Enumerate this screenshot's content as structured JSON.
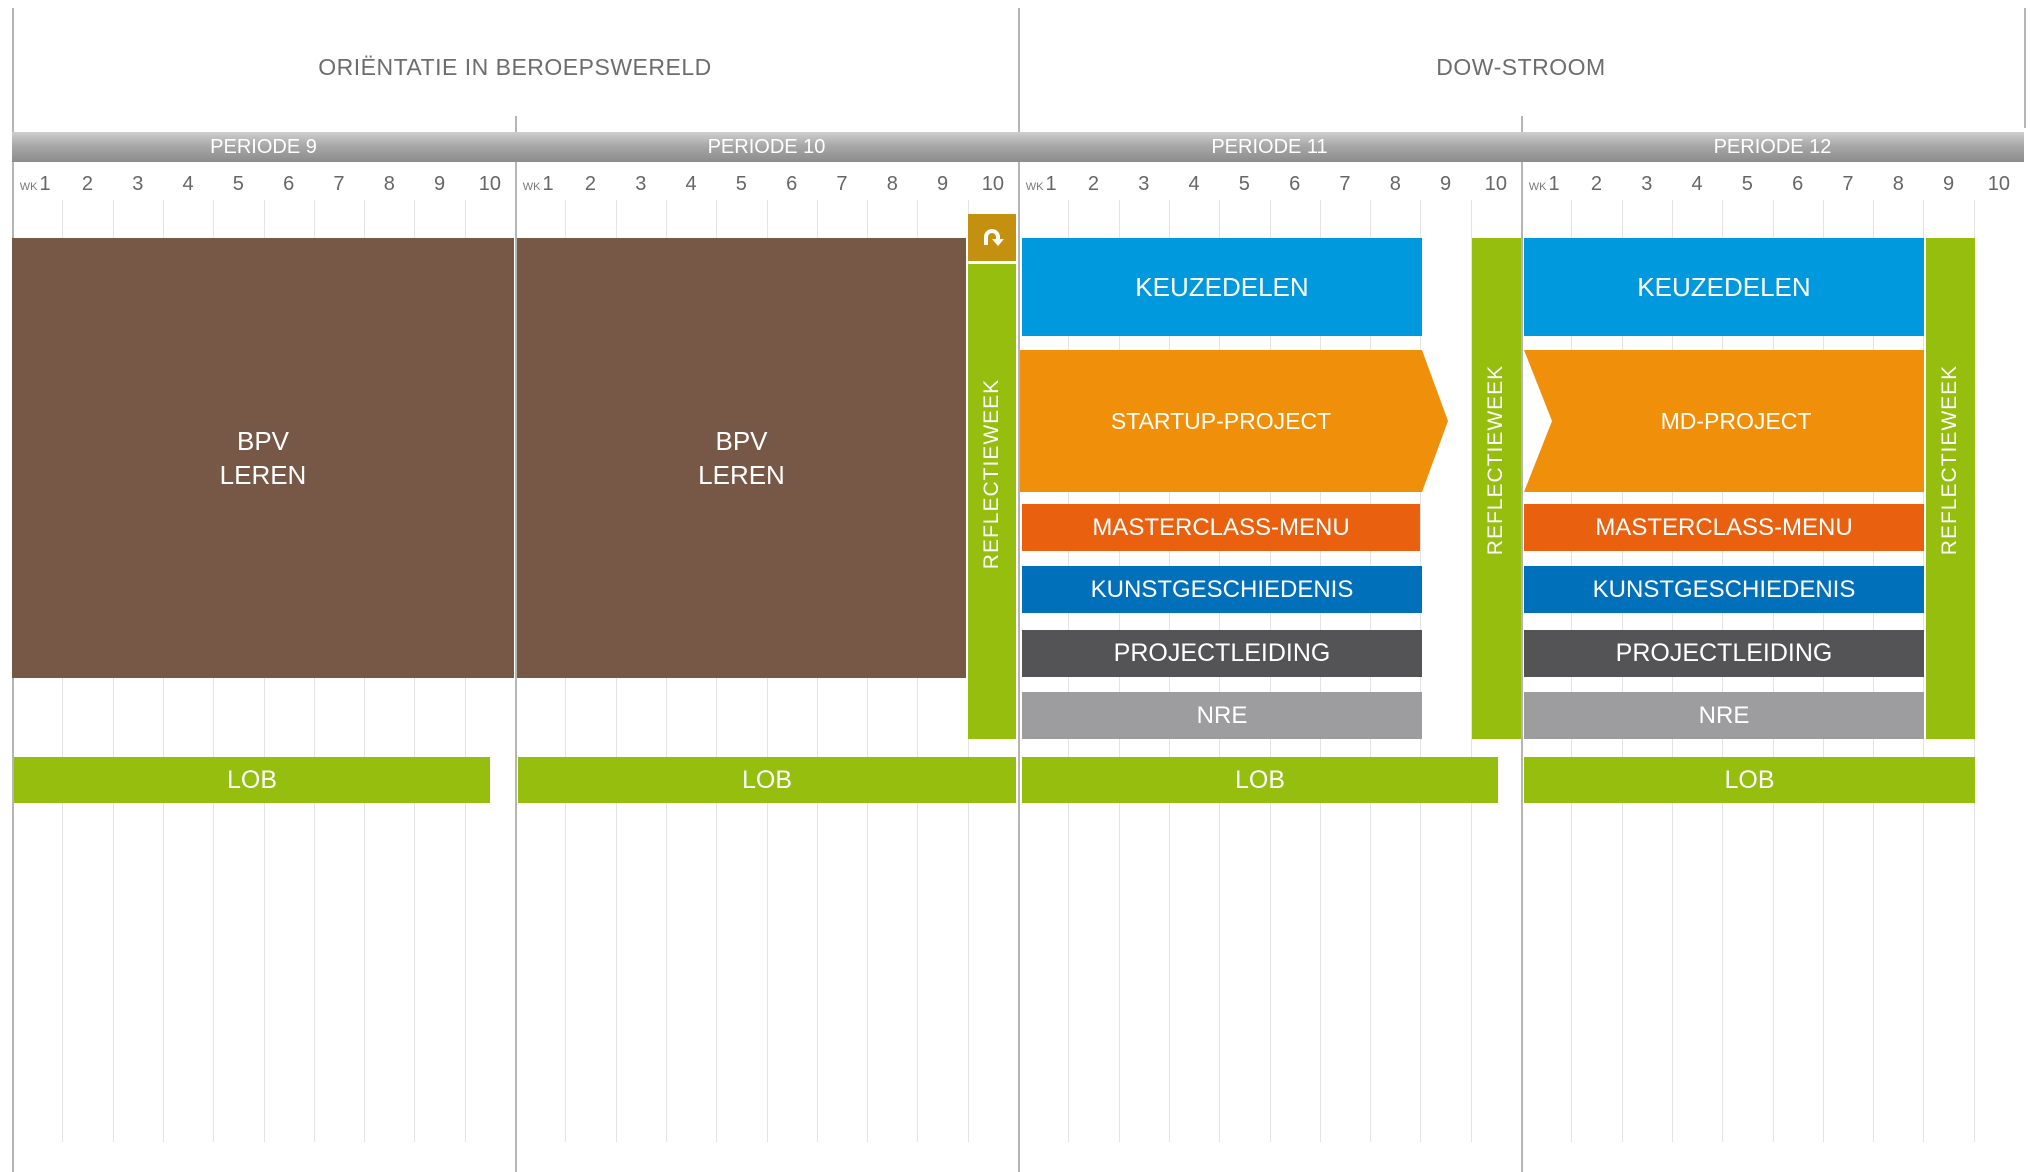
{
  "streams": [
    {
      "title": "ORIËNTATIE IN BEROEPSWERELD"
    },
    {
      "title": "DOW-STROOM"
    }
  ],
  "periods": [
    {
      "label": "PERIODE 9"
    },
    {
      "label": "PERIODE 10"
    },
    {
      "label": "PERIODE 11"
    },
    {
      "label": "PERIODE 12"
    }
  ],
  "week_prefix": "WK",
  "weeks": [
    "1",
    "2",
    "3",
    "4",
    "5",
    "6",
    "7",
    "8",
    "9",
    "10"
  ],
  "blocks": {
    "bpv_p9": {
      "line1": "BPV",
      "line2": "LEREN",
      "color": "#775846"
    },
    "bpv_p10": {
      "line1": "BPV",
      "line2": "LEREN",
      "color": "#775846"
    },
    "reflectieweek": {
      "label": "REFLECTIEWEEK",
      "color": "#95be0f"
    },
    "reflection_icon": {
      "icon": "return-arrow-icon",
      "color": "#c39010"
    },
    "keuzedelen": {
      "label": "KEUZEDELEN",
      "color": "#0099dd"
    },
    "startup_project": {
      "label": "STARTUP-PROJECT",
      "color": "#f0900a"
    },
    "md_project": {
      "label": "MD-PROJECT",
      "color": "#f0900a"
    },
    "masterclass": {
      "label": "MASTERCLASS-MENU",
      "color": "#e9600f"
    },
    "kunstgeschiedenis": {
      "label": "KUNSTGESCHIEDENIS",
      "color": "#0070bb"
    },
    "projectleiding": {
      "label": "PROJECTLEIDING",
      "color": "#545456"
    },
    "nre": {
      "label": "NRE",
      "color": "#9d9d9f"
    },
    "lob": {
      "label": "LOB",
      "color": "#95be0f"
    }
  }
}
